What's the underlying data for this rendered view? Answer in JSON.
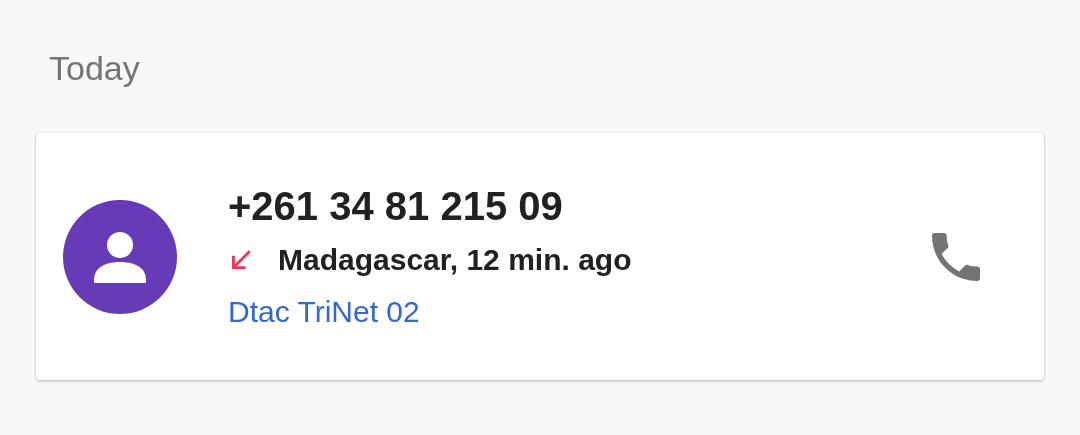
{
  "section_title": "Today",
  "calls": [
    {
      "number": "+261 34 81 215 09",
      "kind": "incoming",
      "details": "Madagascar, 12 min. ago",
      "sim_label": "Dtac TriNet 02"
    }
  ]
}
